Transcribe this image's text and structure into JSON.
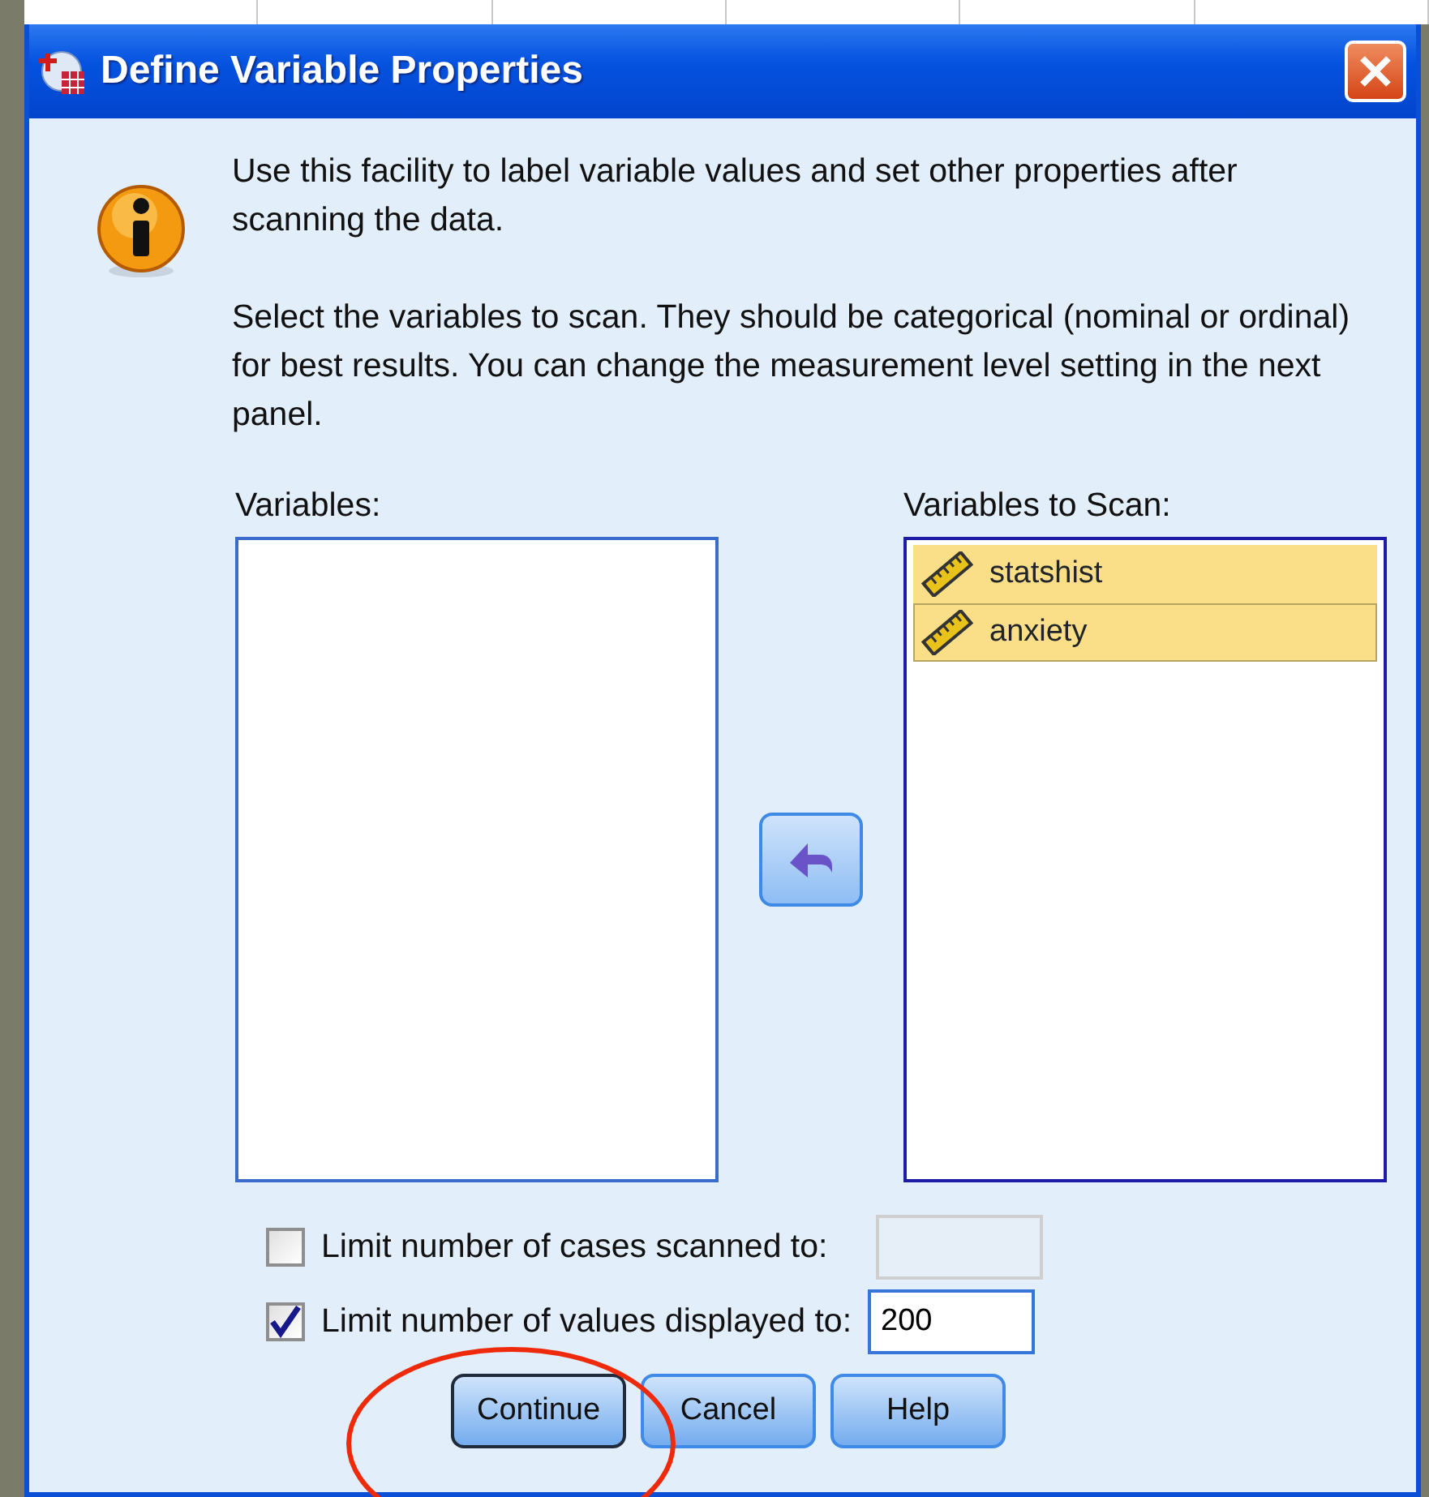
{
  "window": {
    "title": "Define Variable Properties"
  },
  "intro": [
    "Use this facility to label variable values and set other properties after scanning the data.",
    "Select the variables to scan. They should be categorical (nominal or ordinal) for best results. You can change the measurement level setting in the next panel."
  ],
  "variables": {
    "label": "Variables:"
  },
  "scan": {
    "label": "Variables to Scan:",
    "items": [
      {
        "name": "statshist",
        "kind": "scale",
        "selected": true,
        "focused": false
      },
      {
        "name": "anxiety",
        "kind": "scale",
        "selected": true,
        "focused": true
      }
    ]
  },
  "limits": [
    {
      "label": "Limit number of cases scanned to:",
      "checked": false,
      "disabled": true
    },
    {
      "label": "Limit number of values displayed to:",
      "checked": true,
      "disabled": false,
      "value": "200"
    }
  ],
  "buttons": [
    {
      "label": "Continue",
      "default": true,
      "circled": true
    },
    {
      "label": "Cancel",
      "default": false,
      "circled": false
    },
    {
      "label": "Help",
      "default": false,
      "circled": false
    }
  ]
}
